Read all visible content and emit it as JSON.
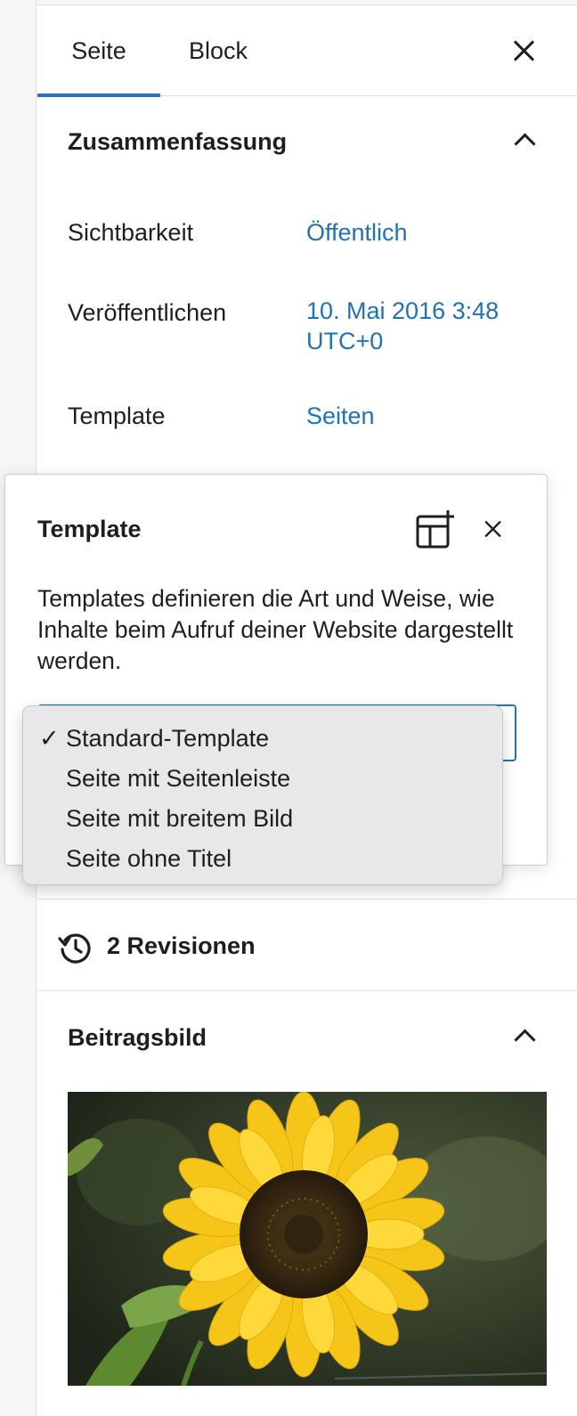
{
  "tabs": [
    {
      "label": "Seite",
      "active": true
    },
    {
      "label": "Block",
      "active": false
    }
  ],
  "summary": {
    "title": "Zusammenfassung",
    "rows": [
      {
        "label": "Sichtbarkeit",
        "value": "Öffentlich"
      },
      {
        "label": "Veröffentlichen",
        "value": "10. Mai 2016 3:48 UTC+0"
      },
      {
        "label": "Template",
        "value": "Seiten"
      }
    ]
  },
  "template_popover": {
    "title": "Template",
    "description": "Templates definieren die Art und Weise, wie Inhalte beim Aufruf deiner Website dargestellt werden."
  },
  "template_dropdown": {
    "selected": "Standard-Template",
    "options": [
      "Standard-Template",
      "Seite mit Seitenleiste",
      "Seite mit breitem Bild",
      "Seite ohne Titel"
    ]
  },
  "revisions": {
    "label": "2 Revisionen"
  },
  "featured_image": {
    "title": "Beitragsbild"
  },
  "colors": {
    "accent": "#2271b1",
    "tab_indicator": "#2a70c9",
    "text": "#1e1e1e"
  },
  "icons": [
    "close-icon",
    "chevron-up-icon",
    "template-add-icon",
    "history-icon",
    "check-icon"
  ]
}
